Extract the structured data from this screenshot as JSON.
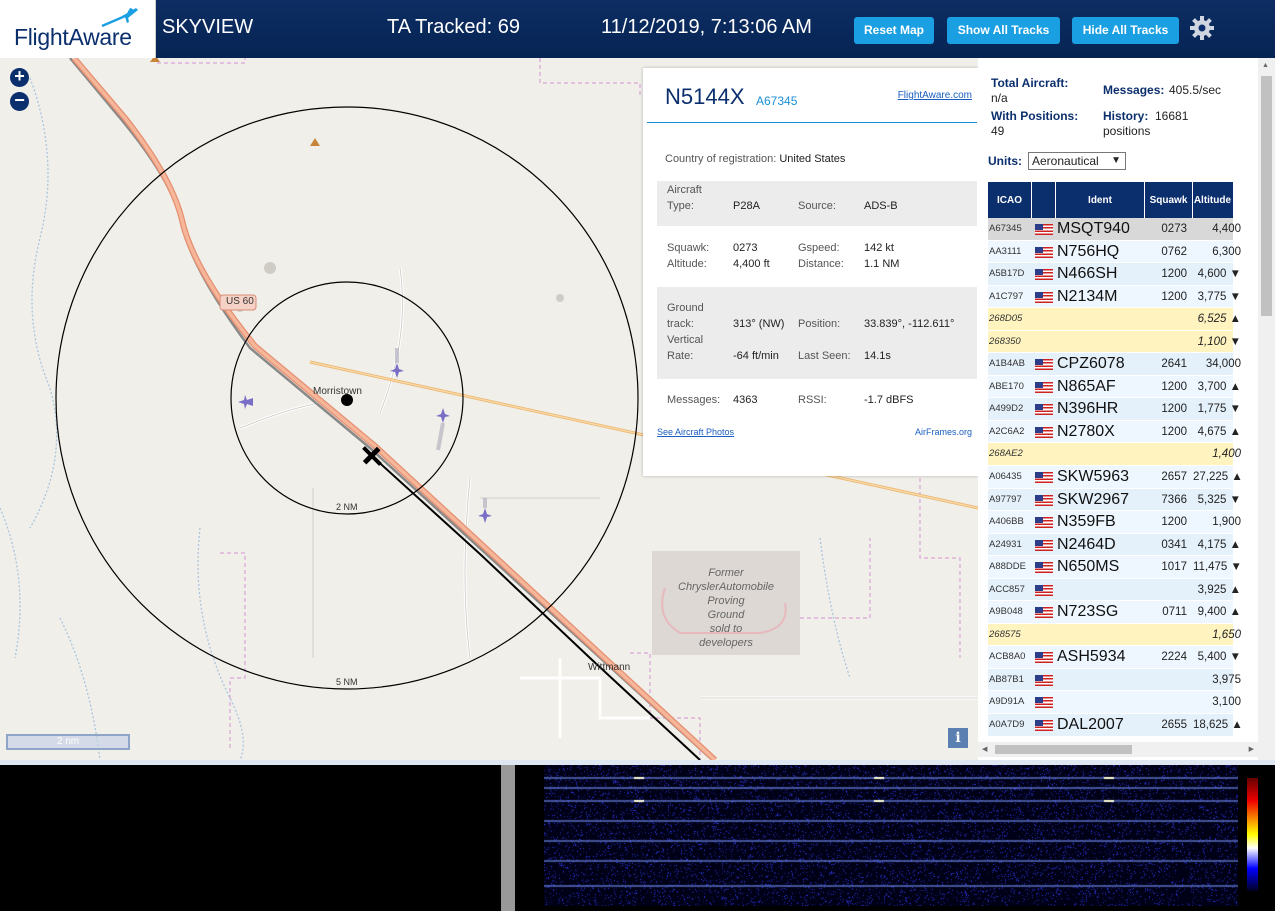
{
  "header": {
    "logo": "FlightAware",
    "app_name": "SKYVIEW",
    "ta_tracked": "TA Tracked: 69",
    "datetime": "11/12/2019, 7:13:06 AM",
    "buttons": {
      "reset": "Reset Map",
      "show_all": "Show All Tracks",
      "hide_all": "Hide All Tracks"
    }
  },
  "map": {
    "zoom_in": "+",
    "zoom_out": "−",
    "scale": "2 nm",
    "info": "i",
    "labels": {
      "road": "US 60",
      "town1": "Morristown",
      "town2": "Wittmann",
      "ring_inner": "2 NM",
      "ring_outer": "5 NM",
      "proving": [
        "Former",
        "ChryslerAutomobile",
        "Proving",
        "Ground",
        "sold to",
        "developers"
      ]
    }
  },
  "popup": {
    "callsign": "N5144X",
    "icao": "A67345",
    "fa_link": "FlightAware.com",
    "country_label": "Country of registration:",
    "country": "United States",
    "aircraft_type_label": "Aircraft Type:",
    "aircraft_type": "P28A",
    "source_label": "Source:",
    "source": "ADS-B",
    "squawk_label": "Squawk:",
    "squawk": "0273",
    "gspeed_label": "Gspeed:",
    "gspeed": "142 kt",
    "altitude_label": "Altitude:",
    "altitude": "4,400 ft",
    "distance_label": "Distance:",
    "distance": "1.1 NM",
    "track_label": "Ground track:",
    "track": "313° (NW)",
    "position_label": "Position:",
    "position": "33.839°, -112.611°",
    "vrate_label": "Vertical Rate:",
    "vrate": "-64 ft/min",
    "last_seen_label": "Last Seen:",
    "last_seen": "14.1s",
    "messages_label": "Messages:",
    "messages": "4363",
    "rssi_label": "RSSI:",
    "rssi": "-1.7 dBFS",
    "photos_link": "See Aircraft Photos",
    "airframes_link": "AirFrames.org"
  },
  "side": {
    "total_aircraft_label": "Total Aircraft:",
    "total_aircraft": "n/a",
    "messages_label": "Messages:",
    "messages": "405.5/sec",
    "with_positions_label": "With Positions:",
    "with_positions": "49",
    "history_label": "History:",
    "history": "16681 positions",
    "units_label": "Units:",
    "units_value": "Aeronautical",
    "columns": [
      "ICAO",
      "",
      "Ident",
      "Squawk",
      "Altitude (ft)"
    ],
    "rows": [
      {
        "icao": "A67345",
        "flag": true,
        "ident": "MSQT940",
        "squawk": "0273",
        "alt": "4,400",
        "pos": true,
        "sel": true
      },
      {
        "icao": "AA3111",
        "flag": true,
        "ident": "N756HQ",
        "squawk": "0762",
        "alt": "6,300",
        "pos": true
      },
      {
        "icao": "A5B17D",
        "flag": true,
        "ident": "N466SH",
        "squawk": "1200",
        "alt": "4,600 ▼",
        "pos": true
      },
      {
        "icao": "A1C797",
        "flag": true,
        "ident": "N2134M",
        "squawk": "1200",
        "alt": "3,775 ▼",
        "pos": true
      },
      {
        "icao": "268D05",
        "flag": false,
        "ident": "",
        "squawk": "",
        "alt": "6,525 ▲",
        "pos": false
      },
      {
        "icao": "268350",
        "flag": false,
        "ident": "",
        "squawk": "",
        "alt": "1,100 ▼",
        "pos": false
      },
      {
        "icao": "A1B4AB",
        "flag": true,
        "ident": "CPZ6078",
        "squawk": "2641",
        "alt": "34,000",
        "pos": true
      },
      {
        "icao": "ABE170",
        "flag": true,
        "ident": "N865AF",
        "squawk": "1200",
        "alt": "3,700 ▲",
        "pos": true
      },
      {
        "icao": "A499D2",
        "flag": true,
        "ident": "N396HR",
        "squawk": "1200",
        "alt": "1,775 ▼",
        "pos": true
      },
      {
        "icao": "A2C6A2",
        "flag": true,
        "ident": "N2780X",
        "squawk": "1200",
        "alt": "4,675 ▲",
        "pos": true
      },
      {
        "icao": "268AE2",
        "flag": false,
        "ident": "",
        "squawk": "",
        "alt": "1,400",
        "pos": false
      },
      {
        "icao": "A06435",
        "flag": true,
        "ident": "SKW5963",
        "squawk": "2657",
        "alt": "27,225 ▲",
        "pos": true
      },
      {
        "icao": "A97797",
        "flag": true,
        "ident": "SKW2967",
        "squawk": "7366",
        "alt": "5,325 ▼",
        "pos": true
      },
      {
        "icao": "A406BB",
        "flag": true,
        "ident": "N359FB",
        "squawk": "1200",
        "alt": "1,900",
        "pos": true
      },
      {
        "icao": "A24931",
        "flag": true,
        "ident": "N2464D",
        "squawk": "0341",
        "alt": "4,175 ▲",
        "pos": true
      },
      {
        "icao": "A88DDE",
        "flag": true,
        "ident": "N650MS",
        "squawk": "1017",
        "alt": "11,475 ▼",
        "pos": true
      },
      {
        "icao": "ACC857",
        "flag": true,
        "ident": "",
        "squawk": "",
        "alt": "3,925 ▲",
        "pos": true
      },
      {
        "icao": "A9B048",
        "flag": true,
        "ident": "N723SG",
        "squawk": "0711",
        "alt": "9,400 ▲",
        "pos": true
      },
      {
        "icao": "268575",
        "flag": false,
        "ident": "",
        "squawk": "",
        "alt": "1,650",
        "pos": false
      },
      {
        "icao": "ACB8A0",
        "flag": true,
        "ident": "ASH5934",
        "squawk": "2224",
        "alt": "5,400 ▼",
        "pos": true
      },
      {
        "icao": "AB87B1",
        "flag": true,
        "ident": "",
        "squawk": "",
        "alt": "3,975",
        "pos": true
      },
      {
        "icao": "A9D91A",
        "flag": true,
        "ident": "",
        "squawk": "",
        "alt": "3,100",
        "pos": true
      },
      {
        "icao": "A0A7D9",
        "flag": true,
        "ident": "DAL2007",
        "squawk": "2655",
        "alt": "18,625 ▲",
        "pos": true
      }
    ]
  },
  "colors": {
    "header_bg": "#0b2f6d",
    "button": "#1a9fe3",
    "accent": "#1a8ed8",
    "nopos_row": "#fff3c0"
  }
}
